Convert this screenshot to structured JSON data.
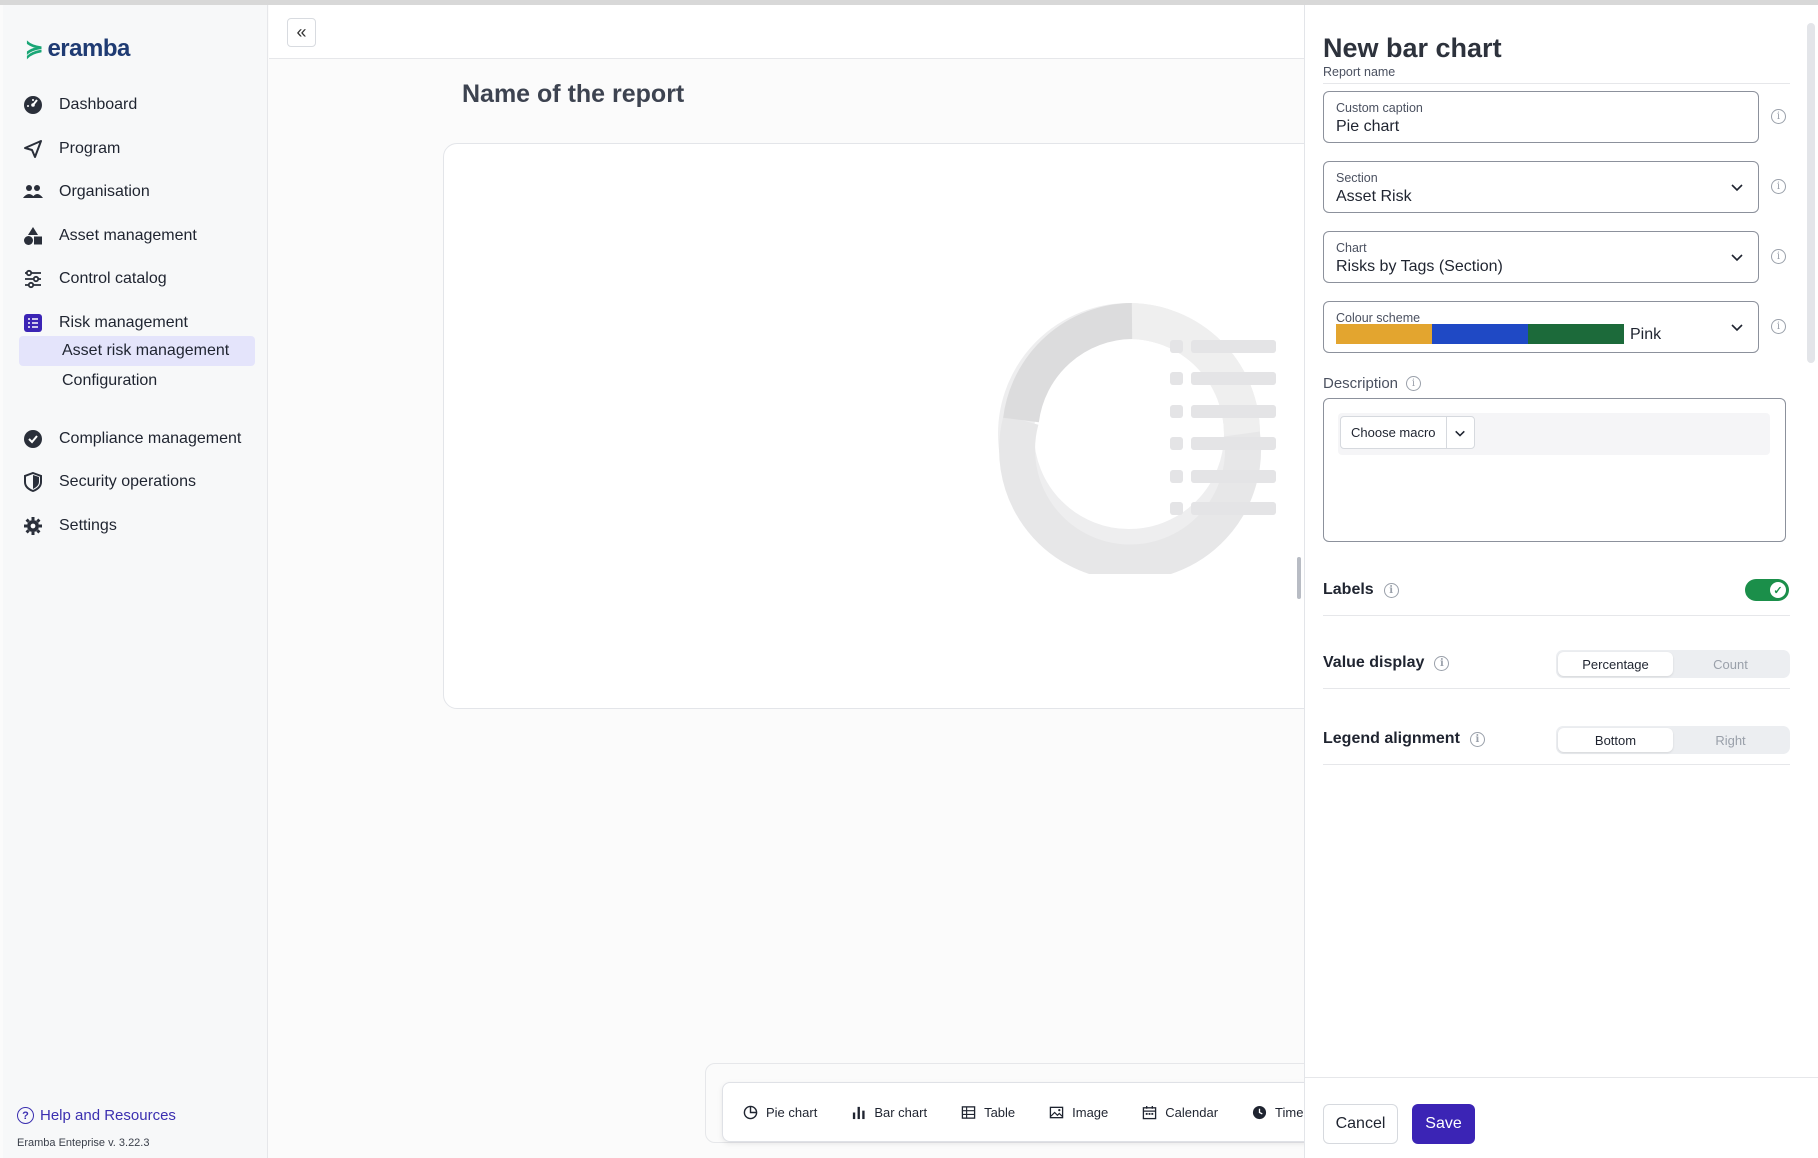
{
  "app": {
    "logo_text": "eramba",
    "logo_mark": "≽"
  },
  "sidebar": {
    "items": [
      {
        "label": "Dashboard",
        "icon": "dashboard-icon"
      },
      {
        "label": "Program",
        "icon": "send-icon"
      },
      {
        "label": "Organisation",
        "icon": "people-icon"
      },
      {
        "label": "Asset management",
        "icon": "shapes-icon"
      },
      {
        "label": "Control catalog",
        "icon": "sliders-icon"
      },
      {
        "label": "Risk management",
        "icon": "list-icon",
        "expanded": true
      },
      {
        "label": "Compliance management",
        "icon": "check-badge-icon"
      },
      {
        "label": "Security operations",
        "icon": "shield-icon"
      },
      {
        "label": "Settings",
        "icon": "gear-icon"
      }
    ],
    "sub_items": [
      {
        "label": "Asset risk management",
        "active": true
      },
      {
        "label": "Configuration",
        "active": false
      }
    ],
    "help": "Help and Resources",
    "version": "Eramba Enteprise v. 3.22.3"
  },
  "main": {
    "collapse_icon": "«",
    "report_title": "Name of the report",
    "toolbar": [
      {
        "label": "Pie chart",
        "icon": "pie-chart-icon"
      },
      {
        "label": "Bar chart",
        "icon": "bar-chart-icon"
      },
      {
        "label": "Table",
        "icon": "table-icon"
      },
      {
        "label": "Image",
        "icon": "image-icon"
      },
      {
        "label": "Calendar",
        "icon": "calendar-icon"
      },
      {
        "label": "Time",
        "icon": "clock-icon"
      }
    ]
  },
  "panel": {
    "title": "New bar chart",
    "subtitle": "Report name",
    "fields": {
      "caption": {
        "label": "Custom caption",
        "value": "Pie chart"
      },
      "section": {
        "label": "Section",
        "value": "Asset Risk"
      },
      "chart": {
        "label": "Chart",
        "value": "Risks by Tags (Section)"
      },
      "colour": {
        "label": "Colour scheme",
        "value": "Pink",
        "swatches": [
          "#e3a52f",
          "#1f49c5",
          "#1c6a3a"
        ]
      }
    },
    "description": {
      "label": "Description",
      "macro_button": "Choose macro"
    },
    "labels": {
      "label": "Labels",
      "enabled": true
    },
    "value_display": {
      "label": "Value display",
      "options": [
        "Percentage",
        "Count"
      ],
      "selected": "Percentage"
    },
    "legend_alignment": {
      "label": "Legend alignment",
      "options": [
        "Bottom",
        "Right"
      ],
      "selected": "Bottom"
    },
    "cancel": "Cancel",
    "save": "Save"
  },
  "colors": {
    "accent": "#3b24b5",
    "toggle_on": "#1b8f4a",
    "active_bg": "#e4e4fb"
  }
}
